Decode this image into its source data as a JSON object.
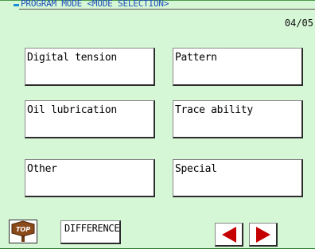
{
  "header": {
    "mode_title": "PROGRAM MODE <MODE SELECTION>",
    "page_counter": "04/05"
  },
  "modes": [
    {
      "label": "Digital tension"
    },
    {
      "label": "Pattern"
    },
    {
      "label": "Oil lubrication"
    },
    {
      "label": "Trace ability"
    },
    {
      "label": "Other"
    },
    {
      "label": "Special"
    }
  ],
  "footer": {
    "top_label": "TOP",
    "difference_label": "DIFFERENCE",
    "prev_icon": "arrow-left-icon",
    "next_icon": "arrow-right-icon"
  },
  "colors": {
    "background": "#d6f7d6",
    "title_text": "#1e4fb8",
    "accent_dash": "#1a8fd4",
    "arrow": "#c40000",
    "top_sign": "#8b4a1a"
  }
}
